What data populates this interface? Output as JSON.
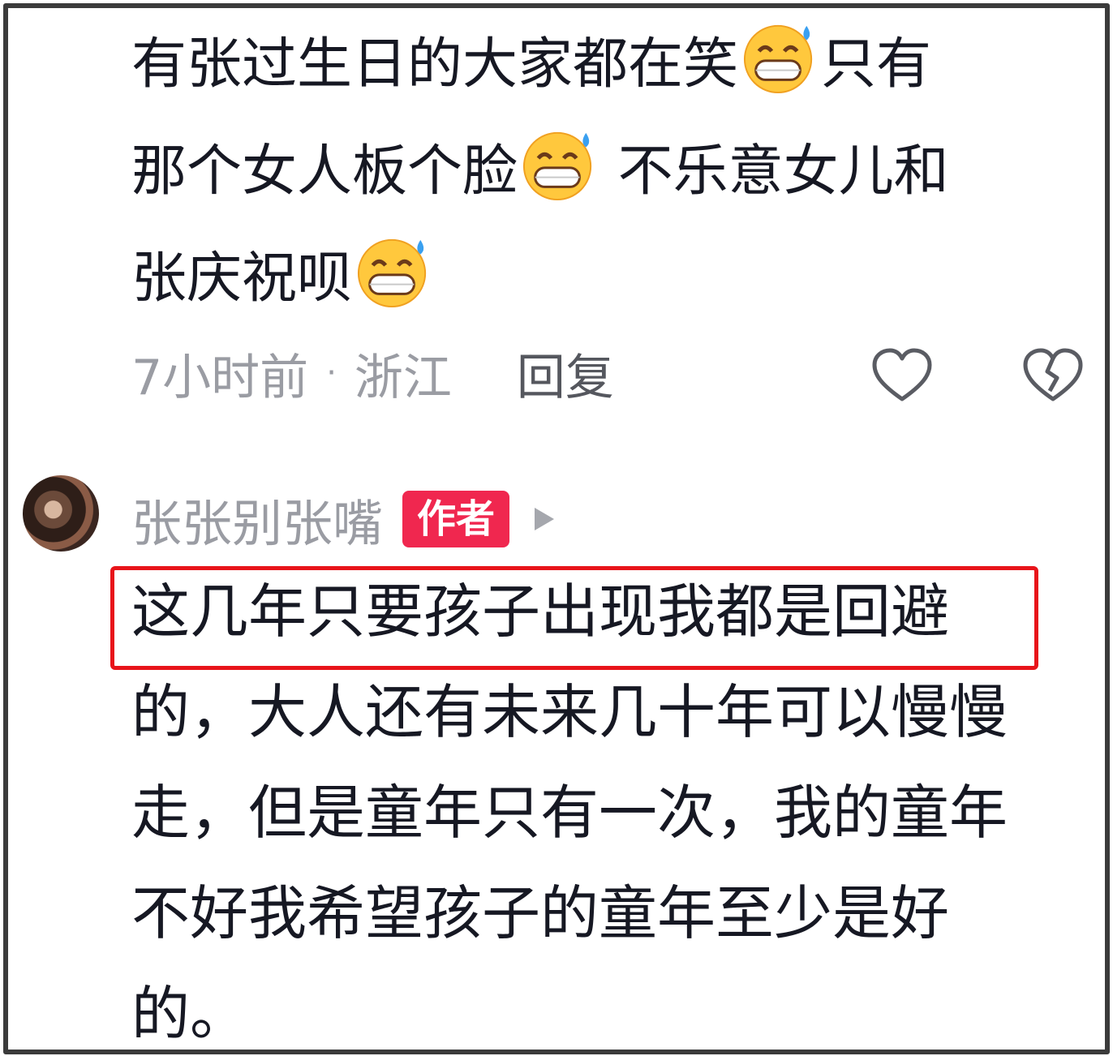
{
  "comment1": {
    "lines": [
      {
        "pre": "有张过生日的大家都在笑",
        "emoji": "sweat-grin-emoji",
        "post": "只有"
      },
      {
        "pre": "那个女人板个脸",
        "emoji": "sweat-grin-emoji",
        "post": " 不乐意女儿和"
      },
      {
        "pre": "张庆祝呗",
        "emoji": "sweat-grin-emoji",
        "post": ""
      }
    ],
    "time": "7小时前",
    "separator": "·",
    "location": "浙江",
    "reply_label": "回复",
    "icons": {
      "like": "heart-outline-icon",
      "dislike": "broken-heart-icon"
    }
  },
  "reply": {
    "author": "张张别张嘴",
    "badge": "作者",
    "lines": [
      "这几年只要孩子出现我都是回避",
      "的，大人还有未来几十年可以慢慢",
      "走，但是童年只有一次，我的童年",
      "不好我希望孩子的童年至少是好",
      "的。"
    ],
    "highlight_color": "#e8141a"
  },
  "colors": {
    "badge": "#f0274f",
    "text": "#161823",
    "meta": "#9a9ca3"
  }
}
